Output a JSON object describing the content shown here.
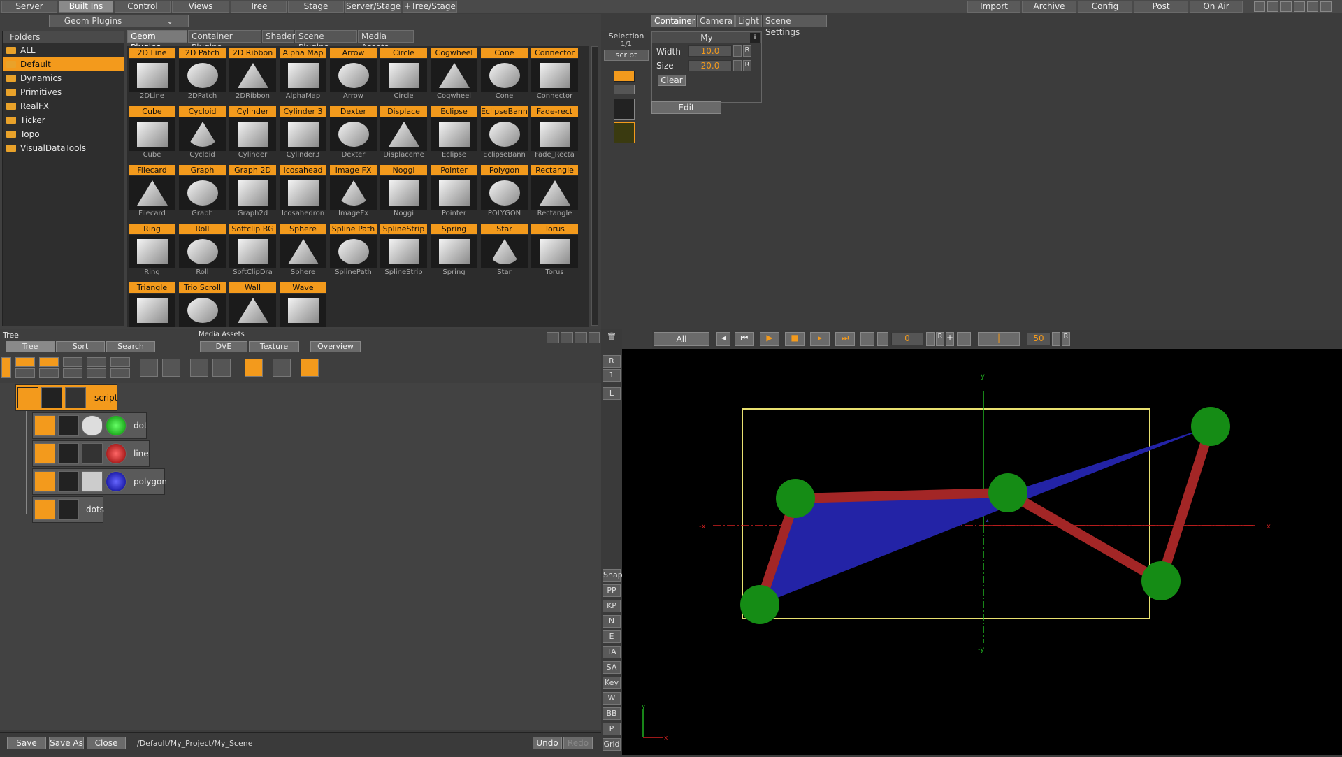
{
  "topbar": {
    "menus": [
      "Server",
      "Built Ins",
      "Control",
      "Views",
      "Tree",
      "Stage",
      "Server/Stage",
      "+Tree/Stage"
    ],
    "right": [
      "Import",
      "Archive",
      "Config",
      "Post",
      "On Air"
    ],
    "active": "Built Ins"
  },
  "library": {
    "category": "Geom Plugins",
    "folders_header": "Folders",
    "folders": [
      "ALL",
      "Default",
      "Dynamics",
      "Primitives",
      "RealFX",
      "Ticker",
      "Topo",
      "VisualDataTools"
    ],
    "selected_folder": "Default",
    "tabs": [
      "Geom Plugins",
      "Container Plugins",
      "Shader",
      "Scene Plugins",
      "Media Assets"
    ],
    "plugins": [
      {
        "label": "2D Line",
        "cap": "2DLine"
      },
      {
        "label": "2D Patch",
        "cap": "2DPatch"
      },
      {
        "label": "2D Ribbon",
        "cap": "2DRibbon"
      },
      {
        "label": "Alpha Map",
        "cap": "AlphaMap"
      },
      {
        "label": "Arrow",
        "cap": "Arrow"
      },
      {
        "label": "Circle",
        "cap": "Circle"
      },
      {
        "label": "Cogwheel",
        "cap": "Cogwheel"
      },
      {
        "label": "Cone",
        "cap": "Cone"
      },
      {
        "label": "Connector",
        "cap": "Connector"
      },
      {
        "label": "Cube",
        "cap": "Cube"
      },
      {
        "label": "Cycloid",
        "cap": "Cycloid"
      },
      {
        "label": "Cylinder",
        "cap": "Cylinder"
      },
      {
        "label": "Cylinder 3",
        "cap": "Cylinder3"
      },
      {
        "label": "Dexter",
        "cap": "Dexter"
      },
      {
        "label": "Displace",
        "cap": "Displaceme"
      },
      {
        "label": "Eclipse",
        "cap": "Eclipse"
      },
      {
        "label": "EclipseBanner",
        "cap": "EclipseBann"
      },
      {
        "label": "Fade-rect",
        "cap": "Fade_Recta"
      },
      {
        "label": "Filecard",
        "cap": "Filecard"
      },
      {
        "label": "Graph",
        "cap": "Graph"
      },
      {
        "label": "Graph 2D",
        "cap": "Graph2d"
      },
      {
        "label": "Icosahead",
        "cap": "Icosahedron"
      },
      {
        "label": "Image FX",
        "cap": "ImageFx"
      },
      {
        "label": "Noggi",
        "cap": "Noggi"
      },
      {
        "label": "Pointer",
        "cap": "Pointer"
      },
      {
        "label": "Polygon",
        "cap": "POLYGON"
      },
      {
        "label": "Rectangle",
        "cap": "Rectangle"
      },
      {
        "label": "Ring",
        "cap": "Ring"
      },
      {
        "label": "Roll",
        "cap": "Roll"
      },
      {
        "label": "Softclip BG",
        "cap": "SoftClipDra"
      },
      {
        "label": "Sphere",
        "cap": "Sphere"
      },
      {
        "label": "Spline Path",
        "cap": "SplinePath"
      },
      {
        "label": "SplineStrip",
        "cap": "SplineStrip"
      },
      {
        "label": "Spring",
        "cap": "Spring"
      },
      {
        "label": "Star",
        "cap": "Star"
      },
      {
        "label": "Torus",
        "cap": "Torus"
      },
      {
        "label": "Triangle",
        "cap": ""
      },
      {
        "label": "Trio Scroll",
        "cap": ""
      },
      {
        "label": "Wall",
        "cap": ""
      },
      {
        "label": "Wave",
        "cap": ""
      }
    ]
  },
  "selection": {
    "title": "Selection",
    "count": "1/1",
    "name": "script"
  },
  "props": {
    "tabs": [
      "Container",
      "Camera",
      "Light",
      "Scene Settings"
    ],
    "panel_title": "My",
    "width_label": "Width",
    "width_value": "10.0",
    "size_label": "Size",
    "size_value": "20.0",
    "clear_label": "Clear",
    "edit_label": "Edit",
    "reset_label": "R"
  },
  "tree": {
    "title": "Tree",
    "tabs": [
      "Tree",
      "Sort",
      "Search"
    ],
    "media_title": "Media Assets",
    "media_tabs": [
      "DVE",
      "Texture",
      "Overview"
    ],
    "nodes": [
      {
        "label": "script"
      },
      {
        "label": "dot",
        "tag": "Circle"
      },
      {
        "label": "line",
        "tag": "2D Line"
      },
      {
        "label": "polygon",
        "tag": "Polygon"
      },
      {
        "label": "dots"
      }
    ]
  },
  "bottom": {
    "save": "Save",
    "save_as": "Save As",
    "close": "Close",
    "path": "/Default/My_Project/My_Scene",
    "undo": "Undo",
    "redo": "Redo"
  },
  "viewctl": {
    "layer": "All",
    "frame": "0",
    "end": "50",
    "reset": "R"
  },
  "sidebar": [
    "Snap",
    "PP",
    "KP",
    "N",
    "E",
    "TA",
    "SA",
    "Key",
    "W",
    "BB",
    "P",
    "Grid"
  ],
  "sidebar_top": [
    "R",
    "1",
    "L"
  ],
  "viewport": {
    "axis_y": "y",
    "axis_ny": "-y",
    "axis_x": "x",
    "axis_nx": "-x",
    "axis_z": "z",
    "origin_y": "y",
    "origin_x": "x",
    "colors": {
      "polygon": "#2323a6",
      "line": "#a32626",
      "dot": "#158c15",
      "safe": "#e8e070",
      "xaxis": "#d02020",
      "yaxis": "#20b020"
    }
  }
}
